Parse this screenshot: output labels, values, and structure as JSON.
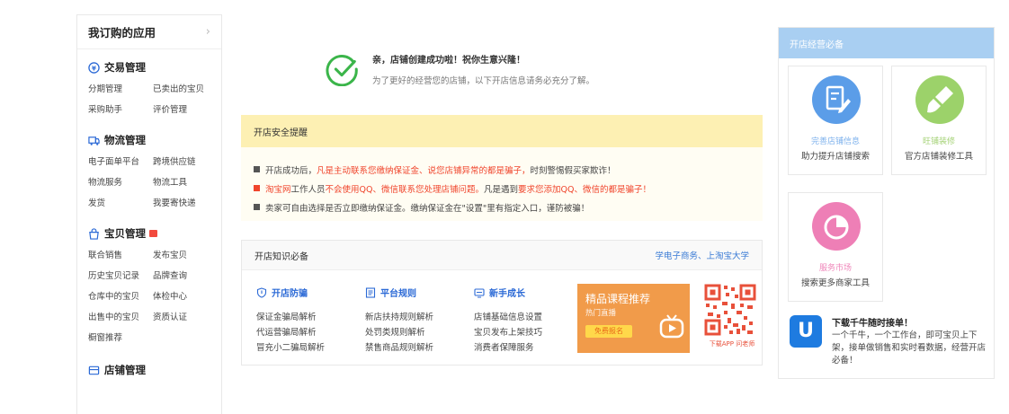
{
  "sidebar": {
    "title": "我订购的应用",
    "sections": [
      {
        "title": "交易管理",
        "items": [
          "分期管理",
          "已卖出的宝贝",
          "采购助手",
          "评价管理"
        ]
      },
      {
        "title": "物流管理",
        "items": [
          "电子面单平台",
          "跨境供应链",
          "物流服务",
          "物流工具",
          "发货",
          "我要寄快递"
        ]
      },
      {
        "title": "宝贝管理",
        "items": [
          "联合销售",
          "发布宝贝",
          "历史宝贝记录",
          "品牌查询",
          "仓库中的宝贝",
          "体检中心",
          "出售中的宝贝",
          "资质认证",
          "橱窗推荐"
        ]
      },
      {
        "title": "店铺管理",
        "items": []
      }
    ]
  },
  "success": {
    "line1": "亲，店铺创建成功啦！祝你生意兴隆！",
    "line2": "为了更好的经营您的店铺，以下开店信息请务必充分了解。"
  },
  "safety": {
    "title": "开店安全提醒",
    "rows": [
      {
        "a": "开店成功后，",
        "b": "凡是主动联系您缴纳保证金、说您店铺异常的都是骗子，",
        "c": "时刻警惕假买家欺诈！"
      },
      {
        "a": "",
        "b": "淘宝网",
        "c": "工作人员",
        "d": "不会使用QQ、微信联系您处理店铺问题。",
        "e": "凡是遇到",
        "f": "要求您添加QQ、微信的都是骗子！"
      },
      {
        "a": "卖家可自由选择是否立即缴纳保证金。缴纳保证金在\"设置\"里有指定入口，谨防被骗！"
      }
    ]
  },
  "knowledge": {
    "title": "开店知识必备",
    "link": "学电子商务、上淘宝大学",
    "cols": [
      {
        "title": "开店防骗",
        "items": [
          "保证金骗局解析",
          "代运营骗局解析",
          "冒充小二骗局解析"
        ]
      },
      {
        "title": "平台规则",
        "items": [
          "新店扶持规则解析",
          "处罚类规则解析",
          "禁售商品规则解析"
        ]
      },
      {
        "title": "新手成长",
        "items": [
          "店铺基础信息设置",
          "宝贝发布上架技巧",
          "消费者保障服务"
        ]
      }
    ],
    "banner": {
      "title": "精品课程推荐",
      "sub": "热门直播",
      "button": "免费报名"
    },
    "qr_caption": "下载APP 问老师"
  },
  "right": {
    "title": "开店经营必备",
    "cards": [
      {
        "title": "完善店铺信息",
        "desc": "助力提升店铺搜索"
      },
      {
        "title": "旺铺装修",
        "desc": "官方店铺装修工具"
      },
      {
        "title": "服务市场",
        "desc": "搜索更多商家工具"
      }
    ],
    "app": {
      "title": "下载千牛随时接单！",
      "desc": "一个千牛，一个工作台，即可宝贝上下架，接单做销售和实时看数据，经营开店必备！"
    }
  },
  "colors": {
    "link_blue": "#3a7bd5",
    "warn_red": "#f0452c",
    "success_green": "#3bb54a"
  }
}
